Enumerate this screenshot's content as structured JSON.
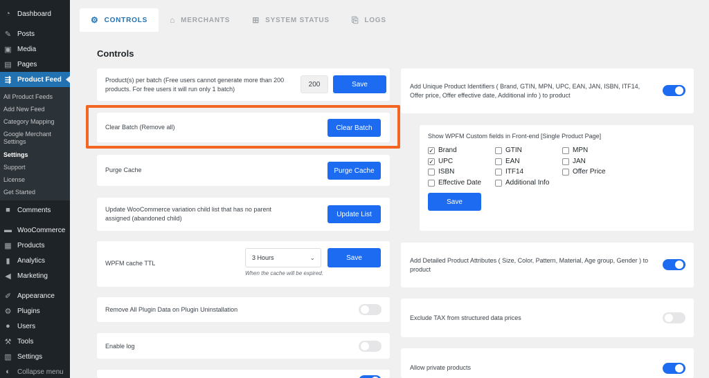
{
  "sidebar": {
    "top_items": [
      {
        "label": "Dashboard",
        "icon": "dashboard-icon",
        "glyph": "◔"
      },
      {
        "label": "Posts",
        "icon": "pushpin-icon",
        "glyph": "✎"
      },
      {
        "label": "Media",
        "icon": "media-icon",
        "glyph": "▣"
      },
      {
        "label": "Pages",
        "icon": "pages-icon",
        "glyph": "▤"
      },
      {
        "label": "Product Feed",
        "icon": "product-feed-icon",
        "glyph": "⇶"
      }
    ],
    "submenu": [
      {
        "label": "All Product Feeds"
      },
      {
        "label": "Add New Feed"
      },
      {
        "label": "Category Mapping"
      },
      {
        "label": "Google Merchant Settings"
      },
      {
        "label": "Settings"
      },
      {
        "label": "Support"
      },
      {
        "label": "License"
      },
      {
        "label": "Get Started"
      }
    ],
    "bottom_items": [
      {
        "label": "Comments",
        "icon": "comments-icon",
        "glyph": "■"
      },
      {
        "label": "WooCommerce",
        "icon": "woocommerce-icon",
        "glyph": "▬"
      },
      {
        "label": "Products",
        "icon": "products-icon",
        "glyph": "▦"
      },
      {
        "label": "Analytics",
        "icon": "analytics-icon",
        "glyph": "▮"
      },
      {
        "label": "Marketing",
        "icon": "megaphone-icon",
        "glyph": "◀"
      },
      {
        "label": "Appearance",
        "icon": "brush-icon",
        "glyph": "✐"
      },
      {
        "label": "Plugins",
        "icon": "plugin-icon",
        "glyph": "⚙"
      },
      {
        "label": "Users",
        "icon": "users-icon",
        "glyph": "●"
      },
      {
        "label": "Tools",
        "icon": "wrench-icon",
        "glyph": "⚒"
      },
      {
        "label": "Settings",
        "icon": "settings-icon",
        "glyph": "▥"
      },
      {
        "label": "Collapse menu",
        "icon": "collapse-icon",
        "glyph": "◐"
      }
    ]
  },
  "tabs": [
    {
      "label": "CONTROLS",
      "icon": "gears-icon",
      "glyph": "⚙"
    },
    {
      "label": "MERCHANTS",
      "icon": "basket-icon",
      "glyph": "⌂"
    },
    {
      "label": "SYSTEM STATUS",
      "icon": "status-icon",
      "glyph": "⊞"
    },
    {
      "label": "LOGS",
      "icon": "document-icon",
      "glyph": "⎘"
    }
  ],
  "page_title": "Controls",
  "left": {
    "batch": {
      "label": "Product(s) per batch (Free users cannot generate more than 200 products. For free users it will run only 1 batch)",
      "value": "200",
      "button": "Save"
    },
    "clear_batch": {
      "label": "Clear Batch (Remove all)",
      "button": "Clear Batch"
    },
    "purge_cache": {
      "label": "Purge Cache",
      "button": "Purge Cache"
    },
    "update_list": {
      "label": "Update WooCommerce variation child list that has no parent assigned (abandoned child)",
      "button": "Update List"
    },
    "cache_ttl": {
      "label": "WPFM cache TTL",
      "selected": "3 Hours",
      "hint": "When the cache will be expired.",
      "button": "Save"
    },
    "remove_data": {
      "label": "Remove All Plugin Data on Plugin Uninstallation",
      "enabled": false
    },
    "enable_log": {
      "label": "Enable log",
      "enabled": false
    }
  },
  "right": {
    "unique_ids": {
      "label": "Add Unique Product Identifiers ( Brand, GTIN, MPN, UPC, EAN, JAN, ISBN, ITF14, Offer price, Offer effective date, Additional info ) to product",
      "enabled": true
    },
    "custom_fields": {
      "title": "Show WPFM Custom fields in Front-end [Single Product Page]",
      "options": [
        {
          "label": "Brand",
          "checked": true
        },
        {
          "label": "GTIN",
          "checked": false
        },
        {
          "label": "MPN",
          "checked": false
        },
        {
          "label": "UPC",
          "checked": true
        },
        {
          "label": "EAN",
          "checked": false
        },
        {
          "label": "JAN",
          "checked": false
        },
        {
          "label": "ISBN",
          "checked": false
        },
        {
          "label": "ITF14",
          "checked": false
        },
        {
          "label": "Offer Price",
          "checked": false
        },
        {
          "label": "Effective Date",
          "checked": false
        },
        {
          "label": "Additional Info",
          "checked": false
        }
      ],
      "button": "Save"
    },
    "detailed_attrs": {
      "label": "Add Detailed Product Attributes ( Size, Color, Pattern, Material, Age group, Gender ) to product",
      "enabled": true
    },
    "exclude_tax": {
      "label": "Exclude TAX from structured data prices",
      "enabled": false
    },
    "private_products": {
      "label": "Allow private products",
      "enabled": true
    }
  },
  "colors": {
    "accent": "#1d6bf0",
    "highlight": "#f26522",
    "sidebar": "#1d2327",
    "active_menu": "#2271b1"
  }
}
